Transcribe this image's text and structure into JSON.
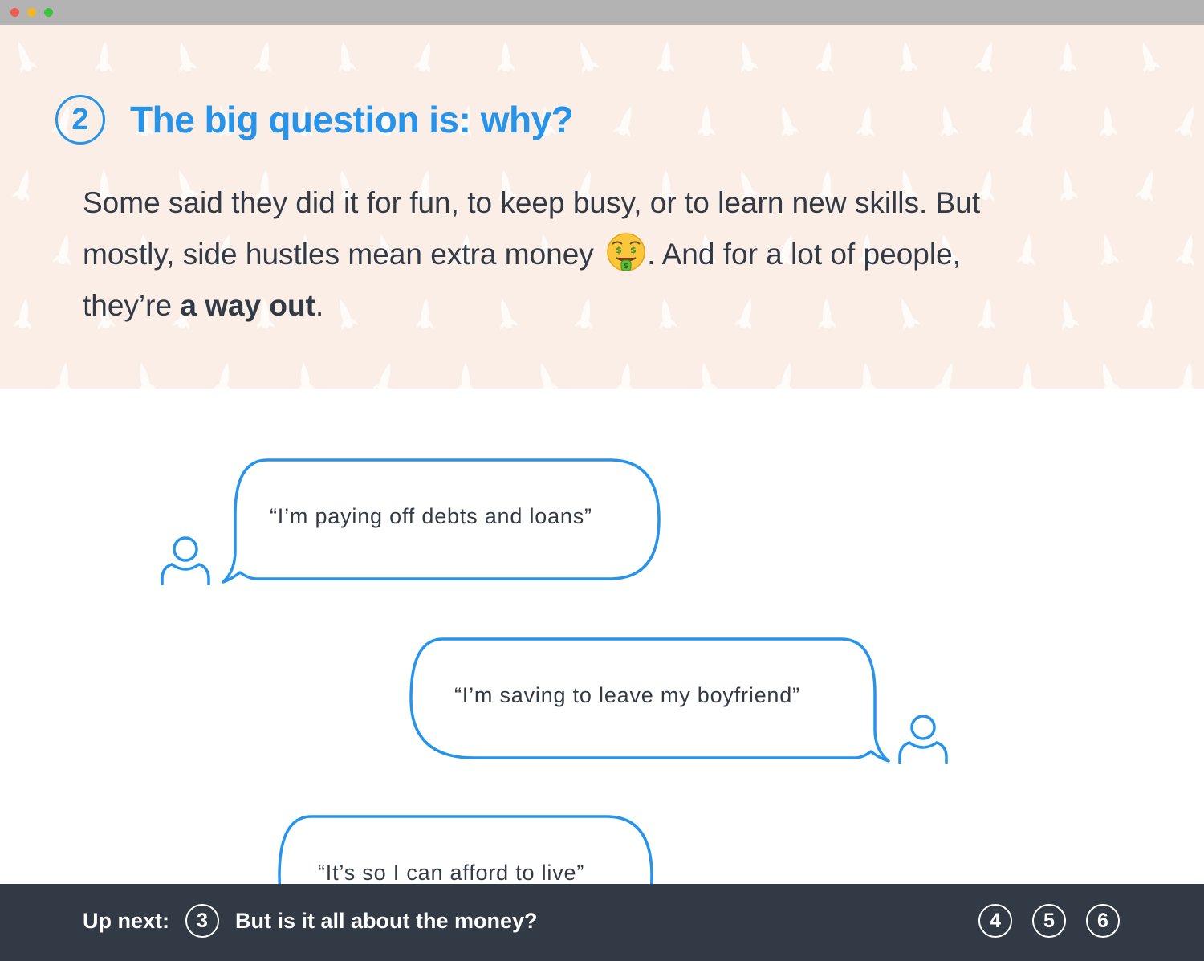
{
  "section": {
    "number": "2",
    "title": "The big question is: why?",
    "intro_line1": "Some said they did it for fun, to keep busy, or to learn new skills. But",
    "intro_line2a": "mostly, side hustles mean extra money ",
    "intro_line2b": ". And for a lot of people,",
    "intro_line3a": "they’re ",
    "intro_bold": "a way out",
    "intro_end": ".",
    "emoji": "money-mouth-face-icon"
  },
  "quotes": [
    {
      "text": "“I’m paying off debts and loans”",
      "side": "left"
    },
    {
      "text": "“I’m saving to leave my boyfriend”",
      "side": "right"
    },
    {
      "text": "“It’s so I can afford to live”",
      "side": "left"
    }
  ],
  "footer": {
    "up_next_label": "Up next:",
    "next_number": "3",
    "next_title": "But is it all about the money?",
    "pages": [
      "4",
      "5",
      "6"
    ]
  },
  "colors": {
    "accent": "#2594ea",
    "hero_bg": "#fbeee6",
    "text": "#313a45",
    "footer_bg": "#313a45"
  }
}
